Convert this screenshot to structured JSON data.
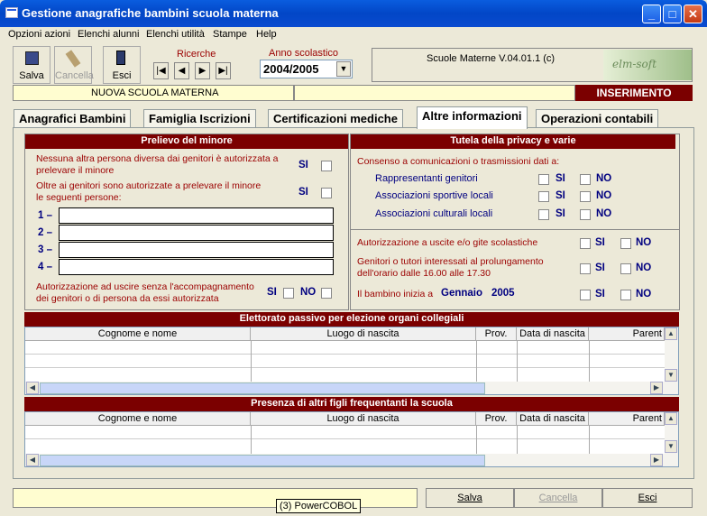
{
  "window": {
    "title": "Gestione anagrafiche bambini scuola materna"
  },
  "menu": {
    "items": [
      "Opzioni azioni",
      "Elenchi alunni",
      "Elenchi utilità",
      "Stampe",
      "Help"
    ]
  },
  "toolbar": {
    "save_label": "Salva",
    "cancel_label": "Cancella",
    "exit_label": "Esci",
    "search_label": "Ricerche",
    "year_label": "Anno scolastico",
    "year_value": "2004/2005",
    "version": "Scuole Materne V.04.01.1 (c)",
    "logo_text": "elm-soft"
  },
  "status": {
    "school_name": "NUOVA SCUOLA MATERNA",
    "mode": "INSERIMENTO"
  },
  "tabs": [
    "Anagrafici Bambini",
    "Famiglia Iscrizioni",
    "Certificazioni mediche",
    "Altre informazioni",
    "Operazioni contabili"
  ],
  "pickup": {
    "header": "Prelievo del minore",
    "q1": "Nessuna altra persona diversa dai genitori è autorizzata a prelevare il minore",
    "q2": "Oltre ai genitori sono autorizzate a prelevare il minore le seguenti persone:",
    "si": "SI",
    "no": "NO",
    "n1": "1 –",
    "n2": "2 –",
    "n3": "3 –",
    "n4": "4 –",
    "q3": "Autorizzazione ad uscire senza l'accompagnamento dei genitori o di persona da essi autorizzata"
  },
  "privacy": {
    "header": "Tutela della privacy e varie",
    "consent": "Consenso a comunicazioni o trasmissioni dati a:",
    "r1": "Rappresentanti genitori",
    "r2": "Associazioni sportive locali",
    "r3": "Associazioni culturali locali",
    "trips": "Autorizzazione a uscite e/o gite scolastiche",
    "extended": "Genitori o tutori interessati al prolungamento dell'orario dalle 16.00 alle 17.30",
    "starts": "Il bambino inizia a",
    "month": "Gennaio",
    "year": "2005",
    "si": "SI",
    "no": "NO"
  },
  "electorate": {
    "header": "Elettorato passivo per elezione organi collegiali",
    "columns": [
      "Cognome e nome",
      "Luogo di nascita",
      "Prov.",
      "Data di nascita",
      "Parent"
    ]
  },
  "siblings": {
    "header": "Presenza di altri figli frequentanti la scuola",
    "columns": [
      "Cognome e nome",
      "Luogo di nascita",
      "Prov.",
      "Data di nascita",
      "Parent"
    ]
  },
  "bottom": {
    "save": "Salva",
    "cancel": "Cancella",
    "exit": "Esci",
    "tooltip": "(3) PowerCOBOL"
  }
}
